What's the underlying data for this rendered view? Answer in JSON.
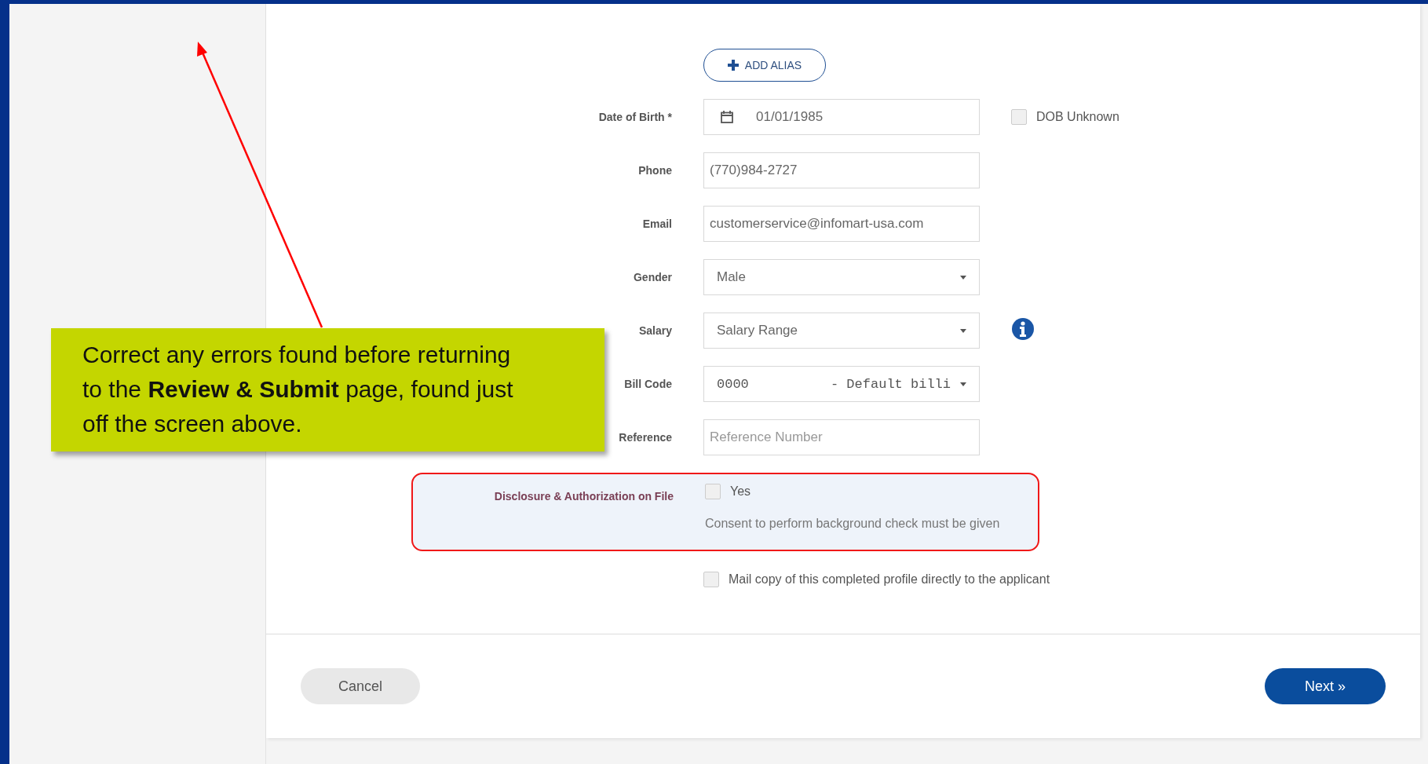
{
  "add_alias_button": {
    "label": "ADD ALIAS"
  },
  "fields": [
    {
      "kind": "date",
      "label": "Date of Birth *",
      "value": "01/01/1985",
      "extra": {
        "kind": "checkbox",
        "label": "DOB Unknown",
        "checked": false
      }
    },
    {
      "kind": "text",
      "label": "Phone",
      "value": "(770)984-2727"
    },
    {
      "kind": "text",
      "label": "Email",
      "value": "customerservice@infomart-usa.com"
    },
    {
      "kind": "select",
      "label": "Gender",
      "value": "Male"
    },
    {
      "kind": "select",
      "label": "Salary",
      "value": "Salary Range",
      "extra": {
        "kind": "info"
      }
    },
    {
      "kind": "code",
      "label": "Bill Code",
      "value": "0000",
      "description": "- Default billi"
    },
    {
      "kind": "text",
      "label": "Reference",
      "placeholder": "Reference Number"
    }
  ],
  "disclosure": {
    "label": "Disclosure & Authorization on File",
    "option": "Yes",
    "checked": false,
    "note": "Consent to perform background check must be given"
  },
  "mail_copy": {
    "label": "Mail copy of this completed profile directly to the applicant",
    "checked": false
  },
  "buttons": {
    "cancel": "Cancel",
    "next": "Next »"
  },
  "callout": {
    "text": "Correct any errors found before returning to the **Review & Submit** page, found just off the screen above."
  }
}
